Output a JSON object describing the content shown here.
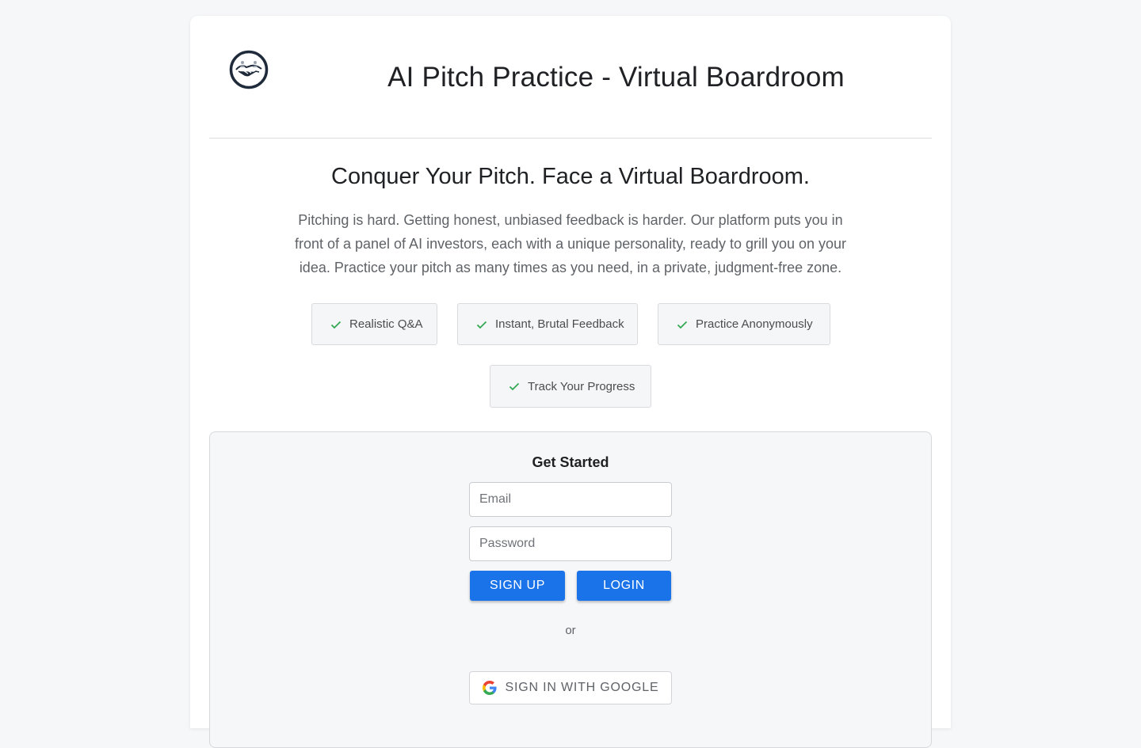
{
  "header": {
    "logo_icon": "handshake-logo-icon",
    "title": "AI Pitch Practice - Virtual Boardroom"
  },
  "hero": {
    "title": "Conquer Your Pitch. Face a Virtual Boardroom.",
    "description": "Pitching is hard. Getting honest, unbiased feedback is harder. Our platform puts you in front of a panel of AI investors, each with a unique personality, ready to grill you on your idea. Practice your pitch as many times as you need, in a private, judgment-free zone."
  },
  "features": [
    {
      "icon": "check-icon",
      "label": "Realistic Q&A"
    },
    {
      "icon": "check-icon",
      "label": "Instant, Brutal Feedback"
    },
    {
      "icon": "check-icon",
      "label": "Practice Anonymously"
    },
    {
      "icon": "check-icon",
      "label": "Track Your Progress"
    }
  ],
  "auth": {
    "title": "Get Started",
    "email": {
      "placeholder": "Email",
      "value": ""
    },
    "password": {
      "placeholder": "Password",
      "value": ""
    },
    "signup_label": "SIGN UP",
    "login_label": "LOGIN",
    "divider_text": "or",
    "google_label": "SIGN IN WITH GOOGLE",
    "google_icon": "google-icon"
  },
  "colors": {
    "primary": "#1a73e8",
    "check": "#34a853",
    "page_background": "#f6f7f9"
  }
}
